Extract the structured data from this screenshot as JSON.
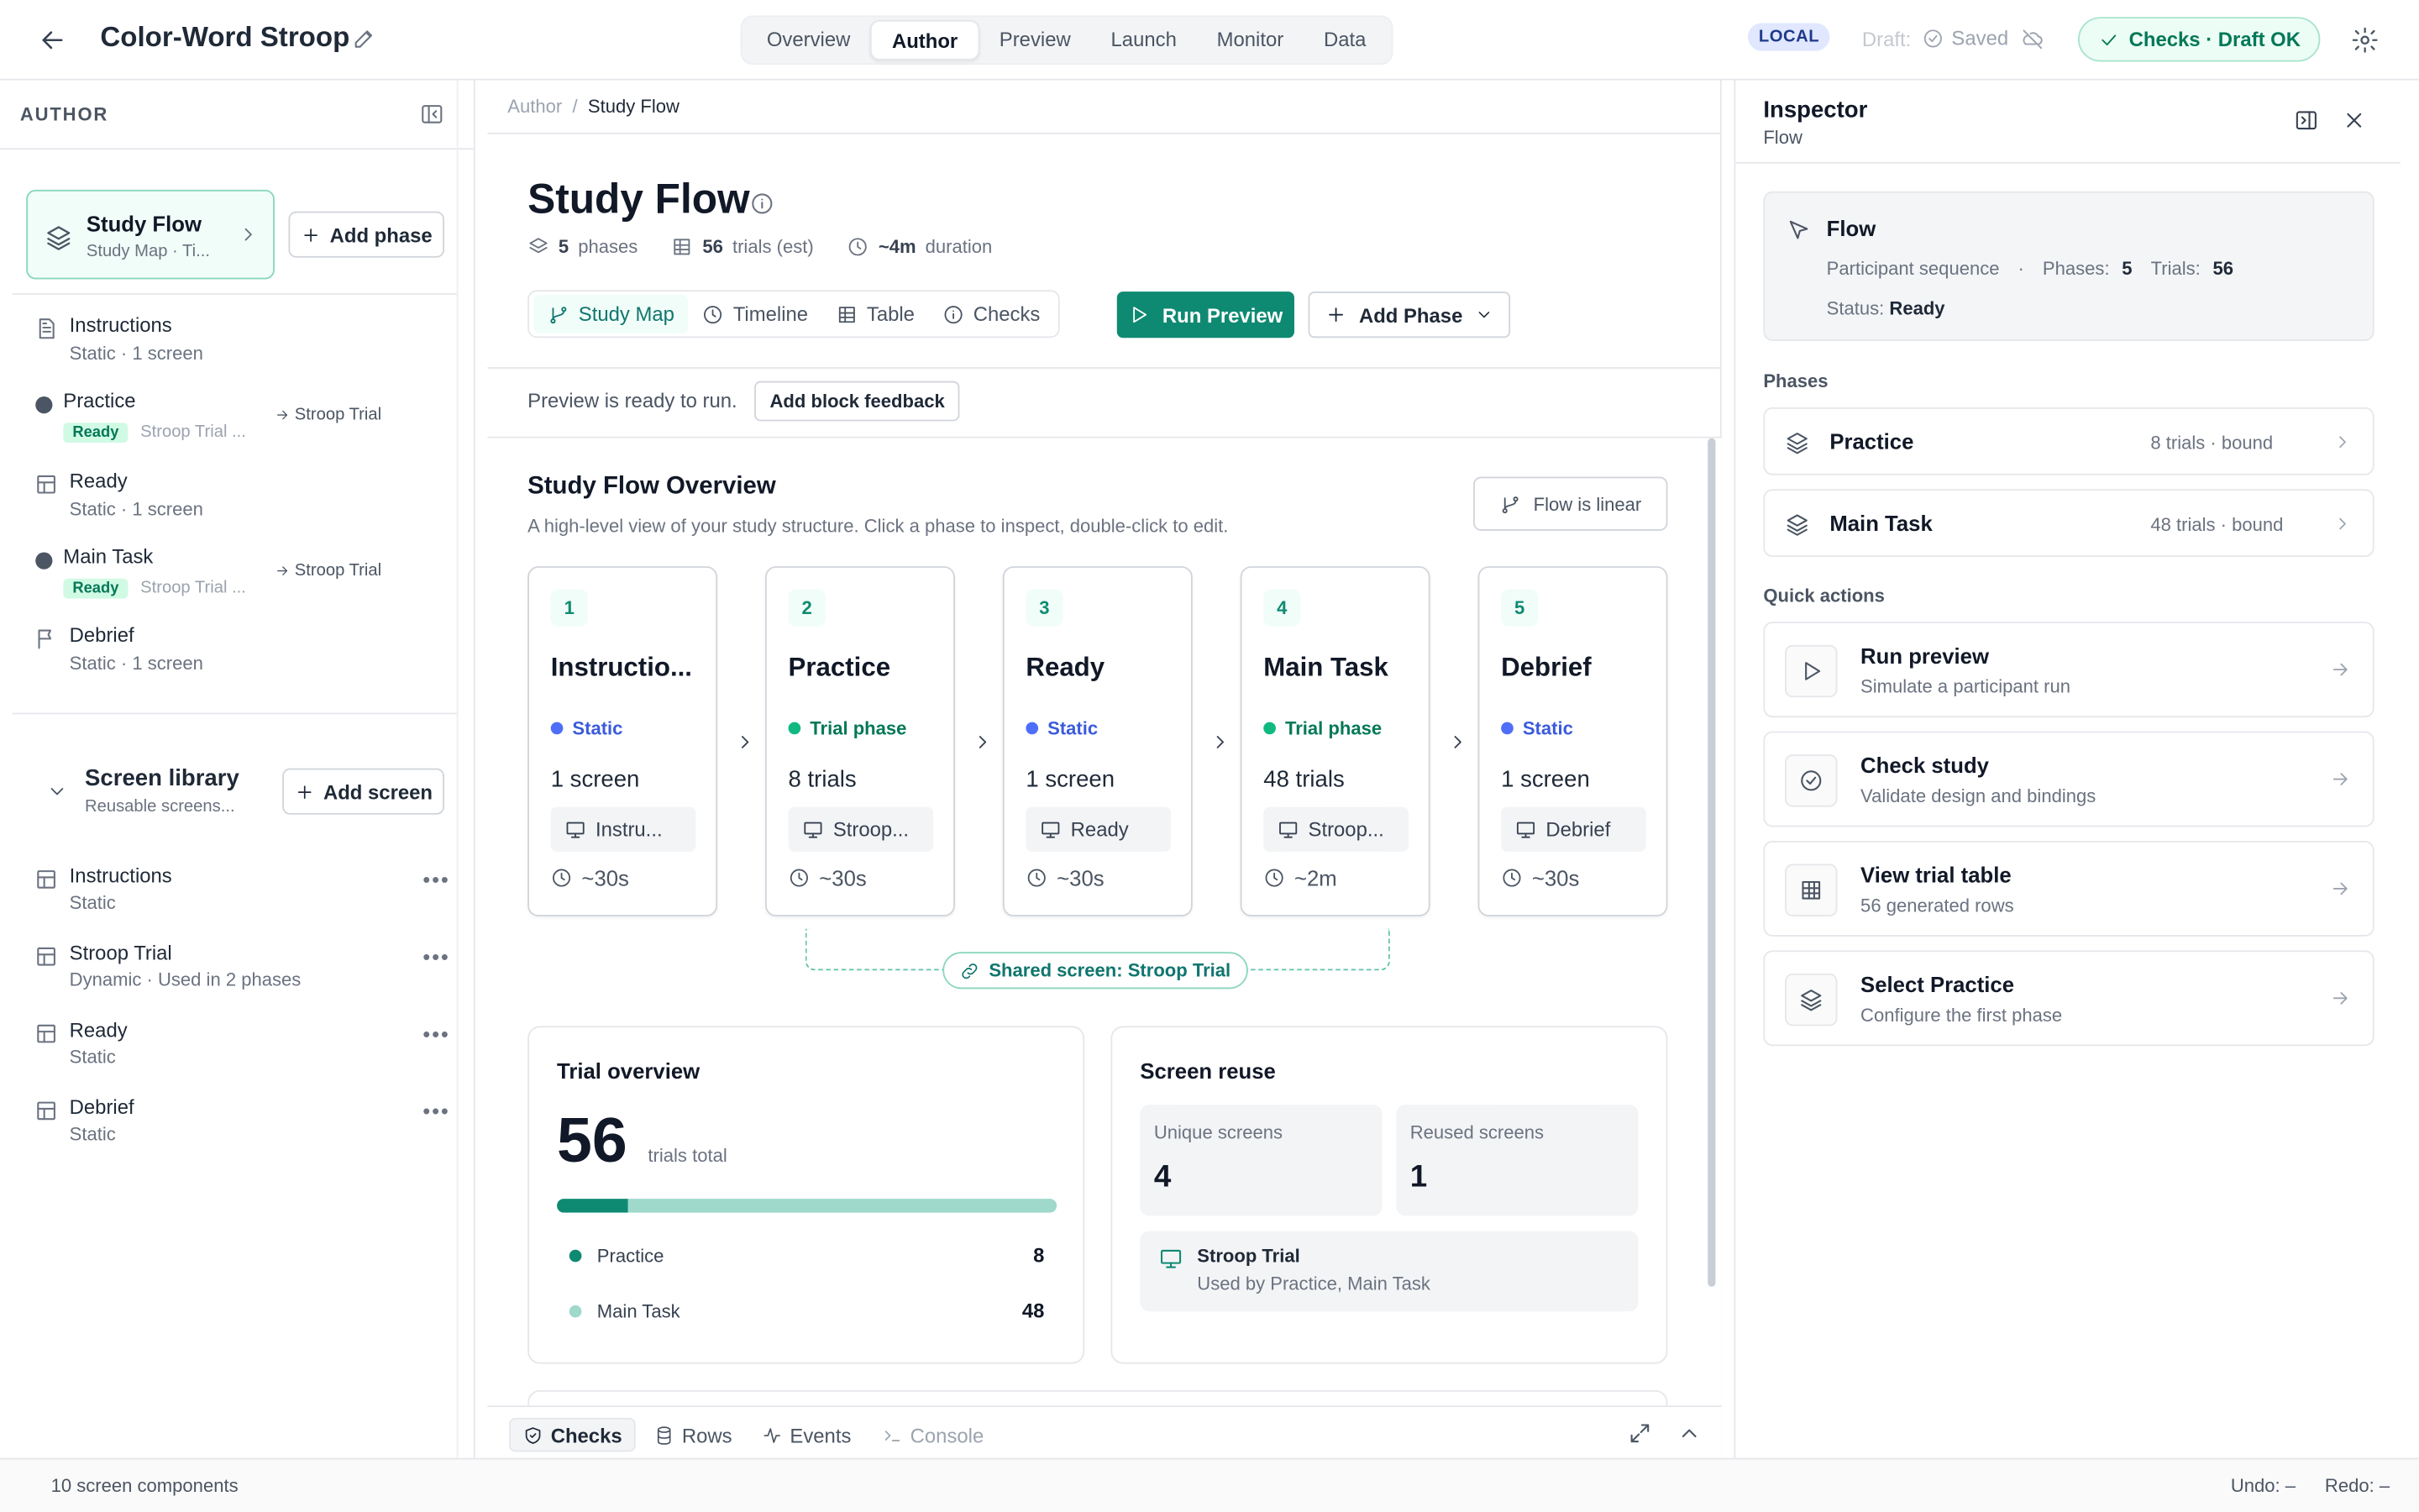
{
  "topbar": {
    "title": "Color-Word Stroop",
    "tabs": [
      "Overview",
      "Author",
      "Preview",
      "Launch",
      "Monitor",
      "Data"
    ],
    "active_tab": "Author",
    "env_badge": "LOCAL",
    "draft_label": "Draft:",
    "saved_label": "Saved",
    "checks_label": "Checks · Draft OK"
  },
  "colors": {
    "accent": "#0f8a72",
    "static_dot": "#4f6ef7",
    "trial_dot": "#10b981",
    "bar_track": "#9fd9cb"
  },
  "left": {
    "header": "AUTHOR",
    "flow_card": {
      "title": "Study Flow",
      "subtitle": "Study Map · Ti..."
    },
    "add_phase": "Add phase",
    "phases": [
      {
        "name": "Instructions",
        "sub": "Static · 1 screen",
        "icon": "document-icon"
      },
      {
        "name": "Practice",
        "badge": "Ready",
        "sub": "Stroop Trial ...",
        "link": "Stroop Trial"
      },
      {
        "name": "Ready",
        "sub": "Static · 1 screen",
        "icon": "layout-icon"
      },
      {
        "name": "Main Task",
        "badge": "Ready",
        "sub": "Stroop Trial ...",
        "link": "Stroop Trial"
      },
      {
        "name": "Debrief",
        "sub": "Static · 1 screen",
        "icon": "flag-icon"
      }
    ],
    "library": {
      "title": "Screen library",
      "subtitle": "Reusable screens...",
      "add_screen": "Add screen",
      "items": [
        {
          "name": "Instructions",
          "sub": "Static"
        },
        {
          "name": "Stroop Trial",
          "sub": "Dynamic · Used in 2 phases"
        },
        {
          "name": "Ready",
          "sub": "Static"
        },
        {
          "name": "Debrief",
          "sub": "Static"
        }
      ]
    }
  },
  "center": {
    "breadcrumb": {
      "parent": "Author",
      "sep": "/",
      "current": "Study Flow"
    },
    "title": "Study Flow",
    "meta": {
      "phases_val": "5",
      "phases_lbl": "phases",
      "trials_val": "56",
      "trials_lbl": "trials (est)",
      "dur_val": "~4m",
      "dur_lbl": "duration"
    },
    "view_tabs": [
      "Study Map",
      "Timeline",
      "Table",
      "Checks"
    ],
    "run_preview": "Run Preview",
    "add_phase": "Add Phase",
    "preview_note": "Preview is ready to run.",
    "block_feedback": "Add block feedback",
    "overview": {
      "title": "Study Flow Overview",
      "subtitle": "A high-level view of your study structure. Click a phase to inspect, double-click to edit.",
      "linear": "Flow is linear",
      "cards": [
        {
          "num": "1",
          "name": "Instructio...",
          "type": "Static",
          "count": "1 screen",
          "screen": "Instru...",
          "dur": "~30s",
          "kind": "static"
        },
        {
          "num": "2",
          "name": "Practice",
          "type": "Trial phase",
          "count": "8 trials",
          "screen": "Stroop...",
          "dur": "~30s",
          "kind": "trial"
        },
        {
          "num": "3",
          "name": "Ready",
          "type": "Static",
          "count": "1 screen",
          "screen": "Ready",
          "dur": "~30s",
          "kind": "static"
        },
        {
          "num": "4",
          "name": "Main Task",
          "type": "Trial phase",
          "count": "48 trials",
          "screen": "Stroop...",
          "dur": "~2m",
          "kind": "trial"
        },
        {
          "num": "5",
          "name": "Debrief",
          "type": "Static",
          "count": "1 screen",
          "screen": "Debrief",
          "dur": "~30s",
          "kind": "static"
        }
      ],
      "shared": "Shared screen: Stroop Trial"
    },
    "trial_overview": {
      "title": "Trial overview",
      "total": "56",
      "total_label": "trials total",
      "practice_fraction": 0.143,
      "rows": [
        {
          "name": "Practice",
          "value": "8"
        },
        {
          "name": "Main Task",
          "value": "48"
        }
      ]
    },
    "screen_reuse": {
      "title": "Screen reuse",
      "unique_label": "Unique screens",
      "unique_value": "4",
      "reused_label": "Reused screens",
      "reused_value": "1",
      "item_name": "Stroop Trial",
      "item_sub": "Used by Practice, Main Task"
    },
    "bottom_tabs": [
      "Checks",
      "Rows",
      "Events",
      "Console"
    ]
  },
  "inspector": {
    "title": "Inspector",
    "subtitle": "Flow",
    "flow": {
      "title": "Flow",
      "desc": "Participant sequence",
      "bullet": "·",
      "phases_lbl": "Phases:",
      "phases_val": "5",
      "trials_lbl": "Trials:",
      "trials_val": "56",
      "status_lbl": "Status:",
      "status_val": "Ready"
    },
    "phases_label": "Phases",
    "phases": [
      {
        "name": "Practice",
        "meta": "8 trials · bound"
      },
      {
        "name": "Main Task",
        "meta": "48 trials · bound"
      }
    ],
    "quick_label": "Quick actions",
    "quick": [
      {
        "name": "Run preview",
        "sub": "Simulate a participant run",
        "icon": "play-icon"
      },
      {
        "name": "Check study",
        "sub": "Validate design and bindings",
        "icon": "check-circle-icon"
      },
      {
        "name": "View trial table",
        "sub": "56 generated rows",
        "icon": "grid-icon"
      },
      {
        "name": "Select Practice",
        "sub": "Configure the first phase",
        "icon": "layers-icon"
      }
    ]
  },
  "statusbar": {
    "left": "10 screen components",
    "undo": "Undo: –",
    "redo": "Redo: –"
  }
}
